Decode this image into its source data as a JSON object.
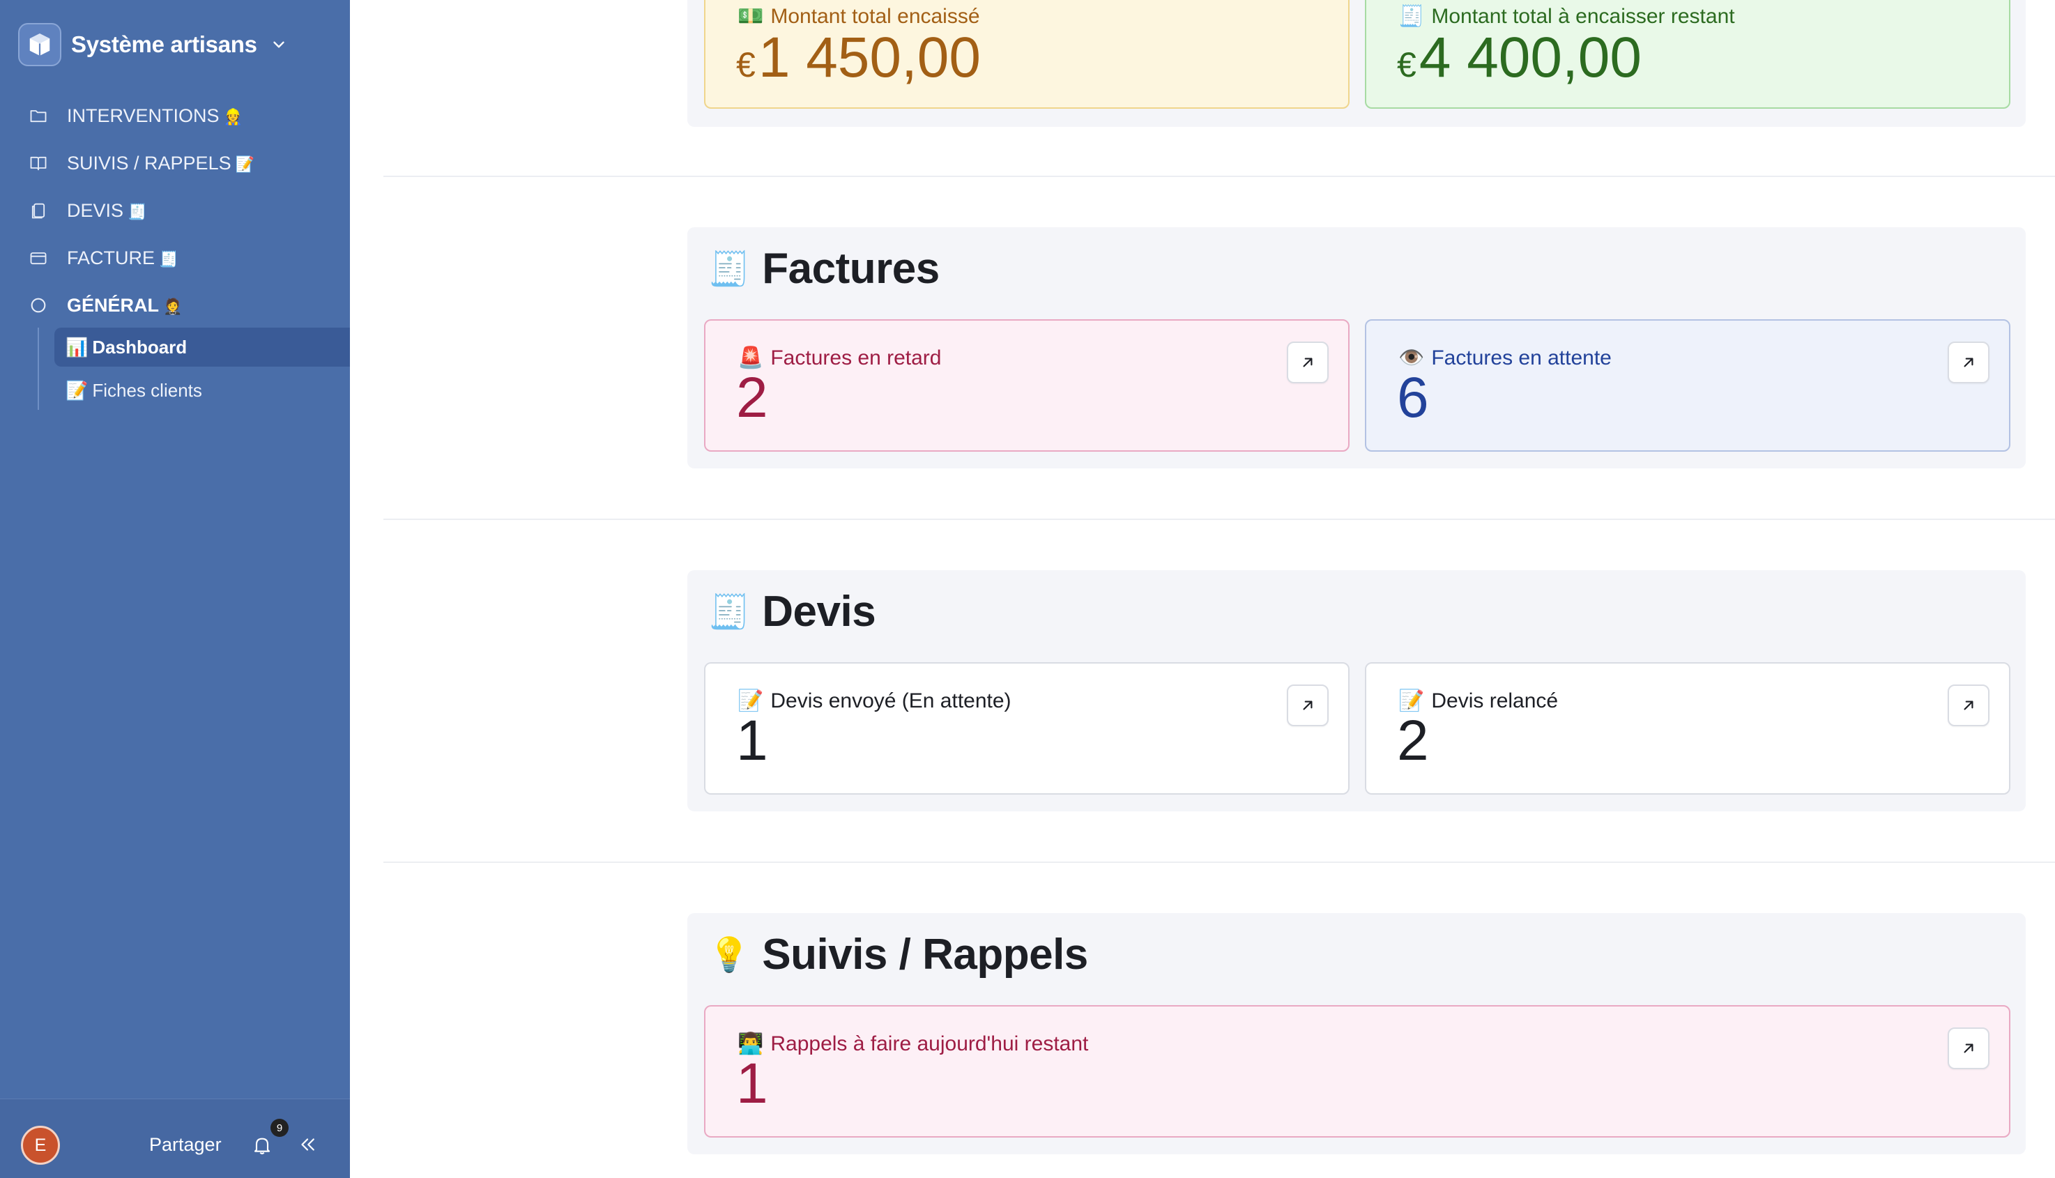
{
  "sidebar": {
    "workspace_name": "Système artisans",
    "nav": [
      {
        "label": "INTERVENTIONS",
        "emoji": "👷",
        "icon": "folder-icon"
      },
      {
        "label": "SUIVIS / RAPPELS",
        "emoji": "📝",
        "icon": "book-icon"
      },
      {
        "label": "DEVIS",
        "emoji": "🧾",
        "icon": "copy-icon"
      },
      {
        "label": "FACTURE",
        "emoji": "🧾",
        "icon": "card-icon"
      },
      {
        "label": "GÉNÉRAL",
        "emoji": "🤵",
        "icon": "circle-icon"
      }
    ],
    "subnav": [
      {
        "label": "Dashboard",
        "emoji": "📊"
      },
      {
        "label": "Fiches clients",
        "emoji": "📝"
      }
    ],
    "footer": {
      "avatar_letter": "E",
      "share_label": "Partager",
      "notification_count": "9"
    }
  },
  "main": {
    "totals": {
      "collected": {
        "emoji": "💵",
        "label": "Montant total encaissé",
        "currency": "€",
        "value": "1 450,00"
      },
      "remaining": {
        "emoji": "🧾",
        "label": "Montant total à encaisser restant",
        "currency": "€",
        "value": "4 400,00"
      }
    },
    "factures": {
      "emoji": "🧾",
      "title": "Factures",
      "late": {
        "emoji": "🚨",
        "label": "Factures en retard",
        "value": "2"
      },
      "pending": {
        "emoji": "👁️",
        "label": "Factures en attente",
        "value": "6"
      }
    },
    "devis": {
      "emoji": "🧾",
      "title": "Devis",
      "sent": {
        "emoji": "📝",
        "label": "Devis envoyé (En attente)",
        "value": "1"
      },
      "reminded": {
        "emoji": "📝",
        "label": "Devis relancé",
        "value": "2"
      }
    },
    "suivis": {
      "emoji": "💡",
      "title": "Suivis / Rappels",
      "today": {
        "emoji": "👨‍💻",
        "label": "Rappels à faire aujourd'hui restant",
        "value": "1"
      }
    }
  },
  "colors": {
    "sidebar_bg": "#4a6ea9",
    "active_item": "#3a5b97",
    "yellow_text": "#a25f15",
    "green_text": "#2c6b20",
    "pink_text": "#9e1d44",
    "blue_text": "#22429a"
  }
}
